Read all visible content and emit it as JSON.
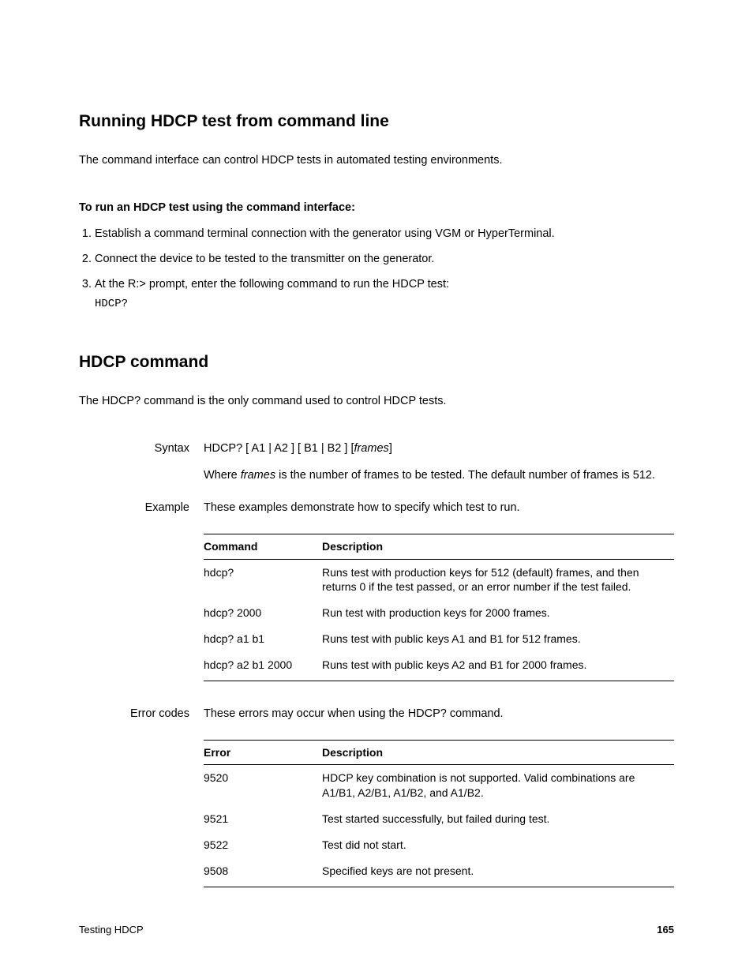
{
  "section1": {
    "title": "Running HDCP test from command line",
    "intro": "The command interface can control HDCP tests in automated testing environments.",
    "proc_title": "To run an HDCP test using the command interface:",
    "steps": [
      "Establish a command terminal connection with the generator using VGM or HyperTerminal.",
      "Connect the device to be tested to the transmitter on the generator.",
      "At the R:> prompt, enter the following command to run the HDCP test:"
    ],
    "step3_cmd": "HDCP?"
  },
  "section2": {
    "title": "HDCP command",
    "intro": "The HDCP? command is the only command used to control HDCP tests."
  },
  "syntax": {
    "label": "Syntax",
    "line_pre": "HDCP? [ A1 | A2 ] [ B1 | B2 ] [",
    "line_var": "frames",
    "line_post": "]",
    "where_pre": "Where ",
    "where_var": "frames",
    "where_post": " is the number of frames to be tested. The default number of frames is 512."
  },
  "example": {
    "label": "Example",
    "intro": "These examples demonstrate how to specify which test to run.",
    "headers": {
      "cmd": "Command",
      "desc": "Description"
    },
    "rows": [
      {
        "cmd": "hdcp?",
        "desc": "Runs test with production keys for 512 (default) frames, and then returns 0 if the test passed, or an error number if the test failed."
      },
      {
        "cmd": "hdcp? 2000",
        "desc": "Run test with production keys for 2000 frames."
      },
      {
        "cmd": "hdcp? a1 b1",
        "desc": "Runs test with public keys A1 and B1 for 512 frames."
      },
      {
        "cmd": "hdcp? a2 b1 2000",
        "desc": "Runs test with public keys A2 and B1 for 2000 frames."
      }
    ]
  },
  "errors": {
    "label": "Error codes",
    "intro": "These errors may occur when using the HDCP? command.",
    "headers": {
      "code": "Error",
      "desc": "Description"
    },
    "rows": [
      {
        "code": "9520",
        "desc": "HDCP key combination is not supported. Valid combinations are A1/B1, A2/B1, A1/B2, and A1/B2."
      },
      {
        "code": "9521",
        "desc": "Test started successfully, but failed during test."
      },
      {
        "code": "9522",
        "desc": "Test did not start."
      },
      {
        "code": "9508",
        "desc": "Specified keys are not present."
      }
    ]
  },
  "footer": {
    "left": "Testing HDCP",
    "right": "165"
  }
}
